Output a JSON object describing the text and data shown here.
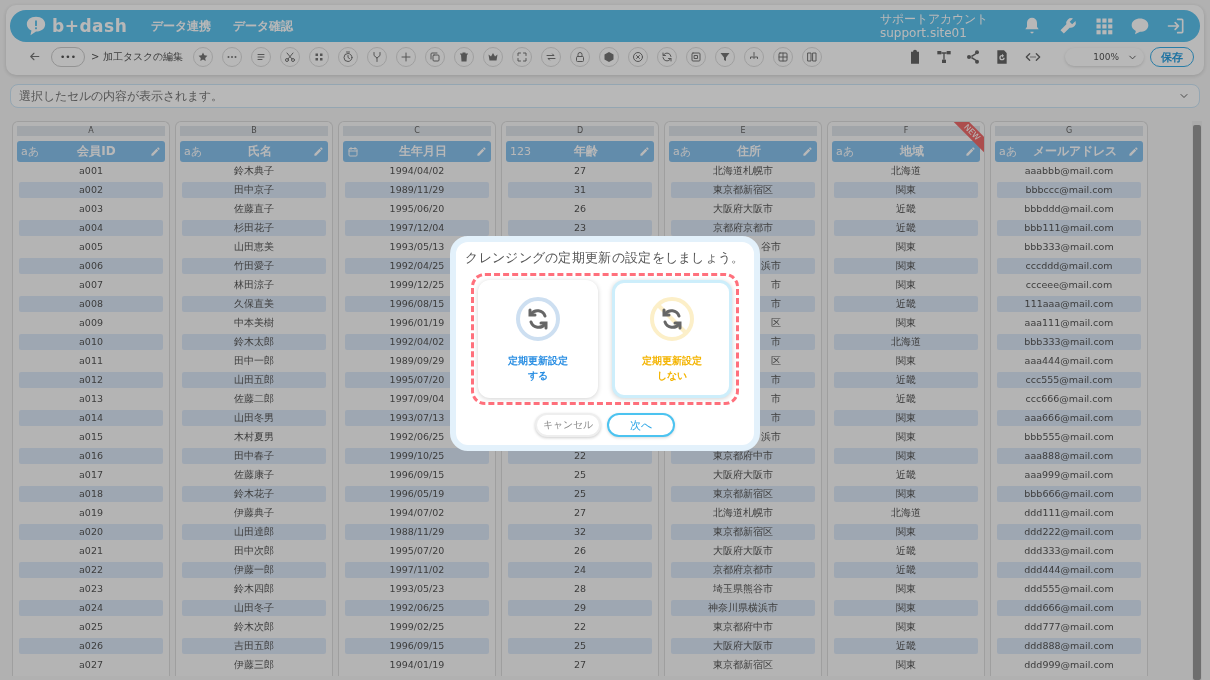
{
  "header": {
    "logo": "b+dash",
    "nav": [
      "データ連携",
      "データ確認"
    ],
    "account": {
      "name": "サポートアカウント",
      "site": "support.site01"
    }
  },
  "toolbar": {
    "more": "•••",
    "breadcrumb": "> 加工タスクの編集",
    "zoom": "100%",
    "save": "保存"
  },
  "formula_bar": {
    "placeholder": "選択したセルの内容が表示されます。"
  },
  "table": {
    "columns": [
      {
        "letter": "A",
        "kind": "text",
        "type_label": "aあ",
        "title": "会員ID",
        "cells": [
          "a001",
          "a002",
          "a003",
          "a004",
          "a005",
          "a006",
          "a007",
          "a008",
          "a009",
          "a010",
          "a011",
          "a012",
          "a013",
          "a014",
          "a015",
          "a016",
          "a017",
          "a018",
          "a019",
          "a020",
          "a021",
          "a022",
          "a023",
          "a024",
          "a025",
          "a026",
          "a027"
        ]
      },
      {
        "letter": "B",
        "kind": "text",
        "type_label": "aあ",
        "title": "氏名",
        "cells": [
          "鈴木典子",
          "田中京子",
          "佐藤直子",
          "杉田花子",
          "山田恵美",
          "竹田愛子",
          "林田涼子",
          "久保直美",
          "中本美樹",
          "鈴木太郎",
          "田中一郎",
          "山田五郎",
          "佐藤二郎",
          "山田冬男",
          "木村夏男",
          "田中春子",
          "佐藤康子",
          "鈴木花子",
          "伊藤典子",
          "山田達郎",
          "田中次郎",
          "伊藤一郎",
          "鈴木四郎",
          "山田冬子",
          "鈴木次郎",
          "吉田五郎",
          "伊藤三郎"
        ]
      },
      {
        "letter": "C",
        "kind": "date",
        "title": "生年月日",
        "cells": [
          "1994/04/02",
          "1989/11/29",
          "1995/06/20",
          "1997/12/04",
          "1993/05/13",
          "1992/04/25",
          "1999/12/25",
          "1996/08/15",
          "1996/01/19",
          "1992/04/02",
          "1989/09/29",
          "1995/07/20",
          "1997/09/04",
          "1993/07/13",
          "1992/06/25",
          "1999/10/25",
          "1996/09/15",
          "1996/05/19",
          "1994/07/02",
          "1988/11/29",
          "1995/07/20",
          "1997/11/02",
          "1993/05/23",
          "1992/06/25",
          "1999/02/25",
          "1996/09/15",
          "1994/01/19"
        ]
      },
      {
        "letter": "D",
        "kind": "number",
        "type_label": "123",
        "title": "年齢",
        "cells": [
          "27",
          "31",
          "26",
          "23",
          null,
          null,
          null,
          null,
          null,
          null,
          null,
          null,
          null,
          null,
          null,
          "22",
          "25",
          "25",
          "27",
          "32",
          "26",
          "24",
          "28",
          "29",
          "22",
          "25",
          "27"
        ]
      },
      {
        "letter": "E",
        "kind": "text",
        "type_label": "aあ",
        "title": "住所",
        "cells": [
          "北海道札幌市",
          "東京都新宿区",
          "大阪府大阪市",
          "京都府京都市",
          {
            "text": "谷市"
          },
          {
            "text": "浜市"
          },
          {
            "text": "市"
          },
          {
            "text": "市"
          },
          {
            "text": "区"
          },
          {
            "text": "市"
          },
          {
            "text": "区"
          },
          {
            "text": "市"
          },
          {
            "text": "市"
          },
          {
            "text": "市"
          },
          {
            "text": "浜市"
          },
          "東京都府中市",
          "大阪府大阪市",
          "東京都新宿区",
          "北海道札幌市",
          "東京都新宿区",
          "大阪府大阪市",
          "京都府京都市",
          "埼玉県熊谷市",
          "神奈川県横浜市",
          "東京都府中市",
          "大阪府大阪市",
          "東京都新宿区"
        ]
      },
      {
        "letter": "F",
        "kind": "text",
        "type_label": "aあ",
        "title": "地域",
        "badge": "NEW",
        "cells": [
          "北海道",
          "関東",
          "近畿",
          "近畿",
          "関東",
          "関東",
          "関東",
          "近畿",
          "関東",
          "北海道",
          "関東",
          "近畿",
          "近畿",
          "関東",
          "関東",
          "関東",
          "近畿",
          "関東",
          "北海道",
          "関東",
          "近畿",
          "近畿",
          "関東",
          "関東",
          "関東",
          "近畿",
          "関東"
        ]
      },
      {
        "letter": "G",
        "kind": "text",
        "type_label": "aあ",
        "title": "メールアドレス",
        "cells": [
          "aaabbb@mail.com",
          "bbbccc@mail.com",
          "bbbddd@mail.com",
          "bbb111@mail.com",
          "bbb333@mail.com",
          "cccddd@mail.com",
          "ccceee@mail.com",
          "111aaa@mail.com",
          "aaa111@mail.com",
          "bbb333@mail.com",
          "aaa444@mail.com",
          "ccc555@mail.com",
          "ccc666@mail.com",
          "aaa666@mail.com",
          "bbb555@mail.com",
          "aaa888@mail.com",
          "aaa999@mail.com",
          "bbb666@mail.com",
          "ddd111@mail.com",
          "ddd222@mail.com",
          "ddd333@mail.com",
          "ddd444@mail.com",
          "ddd555@mail.com",
          "ddd666@mail.com",
          "ddd777@mail.com",
          "ddd888@mail.com",
          "ddd999@mail.com"
        ]
      }
    ]
  },
  "modal": {
    "title": "クレンジングの定期更新の設定をしましょう。",
    "highlighted": true,
    "options": [
      {
        "kind": "enable",
        "label_lines": [
          "定期更新設定",
          "する"
        ],
        "selected": false
      },
      {
        "kind": "disable",
        "label_lines": [
          "定期更新設定",
          "しない"
        ],
        "selected": true
      }
    ],
    "buttons": [
      {
        "kind": "secondary",
        "label": "キャンセル"
      },
      {
        "kind": "primary",
        "label": "次へ"
      }
    ]
  }
}
